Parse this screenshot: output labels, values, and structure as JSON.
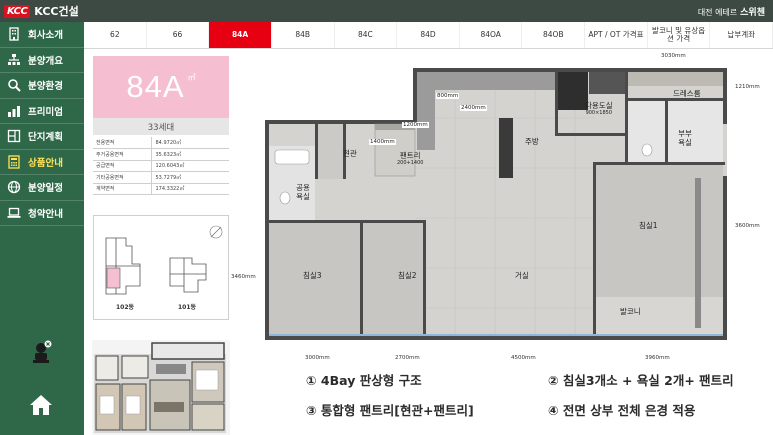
{
  "header": {
    "brand_mark": "KCC",
    "brand_name": "KCC건설",
    "location": "대전 에테르",
    "product": "스위첸"
  },
  "sidebar": {
    "items": [
      {
        "label": "회사소개",
        "icon": "building-icon"
      },
      {
        "label": "분양개요",
        "icon": "site-map-icon"
      },
      {
        "label": "분양환경",
        "icon": "magnifier-icon"
      },
      {
        "label": "프리미엄",
        "icon": "bar-chart-icon"
      },
      {
        "label": "단지계획",
        "icon": "blueprint-icon"
      },
      {
        "label": "상품안내",
        "icon": "calculator-icon"
      },
      {
        "label": "분양일정",
        "icon": "globe-icon"
      },
      {
        "label": "청약안내",
        "icon": "laptop-icon"
      }
    ],
    "active_index": 5
  },
  "tabs": [
    "62",
    "66",
    "84A",
    "84B",
    "84C",
    "84D",
    "84OA",
    "84OB",
    "APT / OT 가격표",
    "발코니 및 유상옵션 가격",
    "납부계좌"
  ],
  "active_tab": "84A",
  "unit": {
    "type": "84A",
    "area_unit": "㎡",
    "households": "33세대",
    "areas": [
      {
        "label": "전용면적",
        "value": "84.9720㎡"
      },
      {
        "label": "주거공용면적",
        "value": "35.6323㎡"
      },
      {
        "label": "공급면적",
        "value": "120.6043㎡"
      },
      {
        "label": "기타공용면적",
        "value": "53.7279㎡"
      },
      {
        "label": "계약면적",
        "value": "174.3322㎡"
      }
    ]
  },
  "siteplan": {
    "buildings": [
      "102동",
      "101동"
    ]
  },
  "plan": {
    "rooms": {
      "dressroom": "드레스룸",
      "dining": "다용도실",
      "dining_size": "900×1850",
      "kitchen": "주방",
      "bath2": "부부 욕실",
      "entrance": "현관",
      "pantry": "팬트리",
      "pantry_size": "200+1400",
      "common_bath": "공용 욕실",
      "bed1": "침실1",
      "bed2": "침실2",
      "bed3": "침실3",
      "living": "거실",
      "balcony": "발코니"
    },
    "dims": {
      "top": "3030mm",
      "right_top": "1210mm",
      "right_mid": "3600mm",
      "left": "3460mm",
      "d800": "800mm",
      "d2400": "2400mm",
      "d1200": "1200mm",
      "d1400": "1400mm",
      "b1": "3000mm",
      "b2": "2700mm",
      "b3": "4500mm",
      "b4": "3960mm"
    }
  },
  "features": [
    "① 4Bay 판상형 구조",
    "② 침실3개소 + 욕실 2개+ 팬트리",
    "③ 통합형 팬트리[현관+팬트리]",
    "④ 전면 상부 전체 은경 적용"
  ],
  "colors": {
    "header": "#3d4a44",
    "sidebar": "#2f6848",
    "active_nav": "#ffe15a",
    "active_tab": "#e60012",
    "type_box": "#f5bed1"
  }
}
